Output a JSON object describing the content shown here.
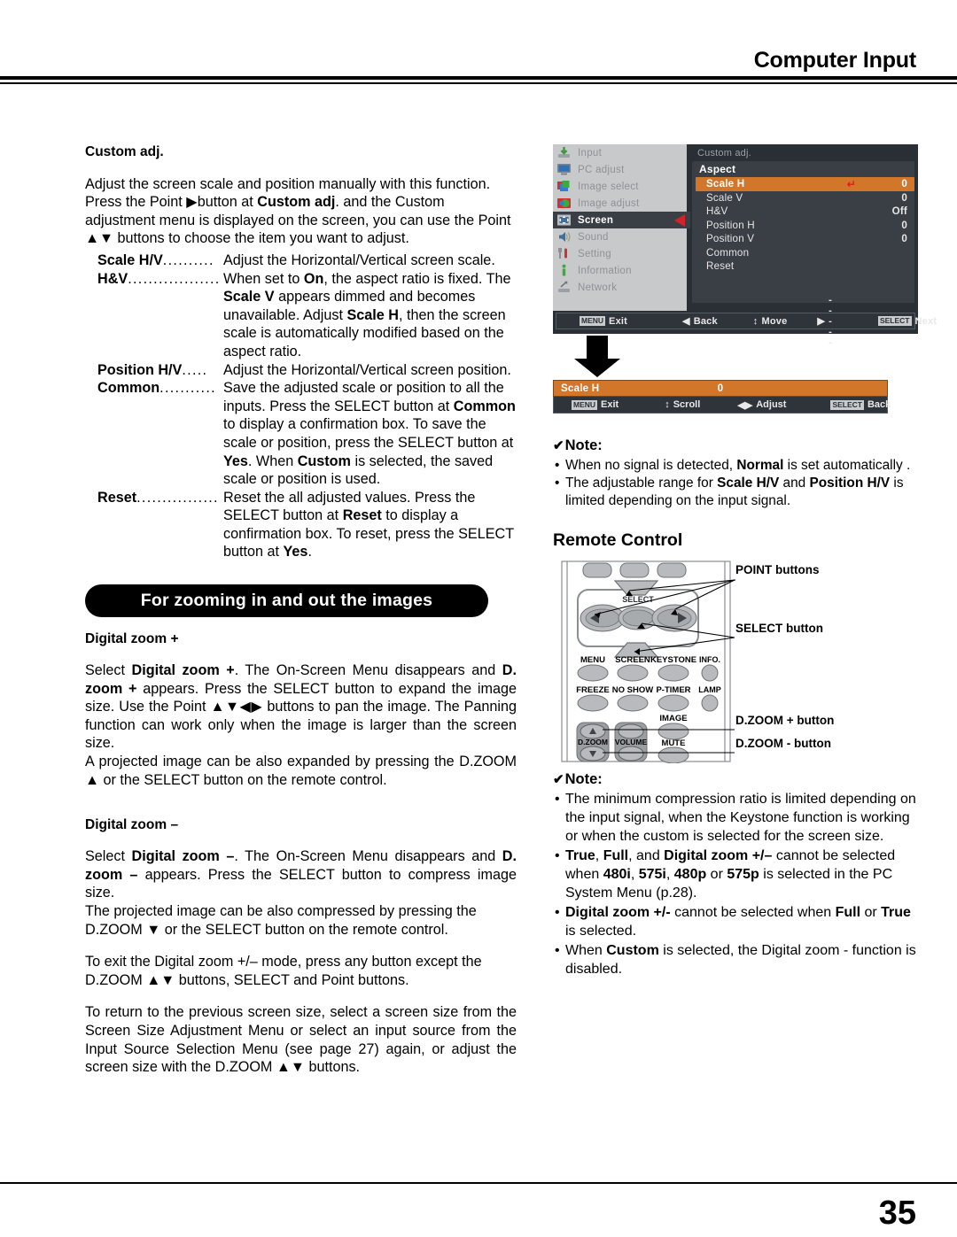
{
  "header": {
    "title": "Computer Input"
  },
  "footer": {
    "page_number": "35"
  },
  "left": {
    "section_title": "Custom adj.",
    "intro_p1": "Adjust the screen scale and position manually with this function.",
    "intro_p2_a": "Press the Point ",
    "intro_p2_arrow": "▶",
    "intro_p2_b": "button at ",
    "intro_p2_bold": "Custom adj",
    "intro_p2_c": ". and the Custom adjustment menu is displayed on the screen, you can use the Point ",
    "intro_p2_updown": "▲▼",
    "intro_p2_d": " buttons to choose the item you want to adjust.",
    "definitions": [
      {
        "term": "Scale H/V",
        "dots": "..........",
        "desc": "Adjust the Horizontal/Vertical screen scale."
      },
      {
        "term": "H&V",
        "dots": "..................",
        "desc_1": "When set to ",
        "desc_b1": "On",
        "desc_2": ", the aspect ratio is fixed. The ",
        "desc_b2": "Scale V",
        "desc_3": " appears dimmed and becomes unavailable. Adjust ",
        "desc_b3": "Scale H",
        "desc_4": ", then the screen scale is automatically modified based on the aspect ratio."
      },
      {
        "term": "Position H/V",
        "dots": ".....",
        "desc": "Adjust the Horizontal/Vertical screen position."
      },
      {
        "term": "Common",
        "dots": "...........",
        "desc_1": "Save the adjusted scale or position to all the inputs. Press the SELECT button at ",
        "desc_b1": "Common",
        "desc_2": " to display a confirmation box. To save the scale or position, press the SELECT button at ",
        "desc_b2": "Yes",
        "desc_3": ". When ",
        "desc_b3": "Custom",
        "desc_4": " is selected, the saved scale or position is used."
      },
      {
        "term": "Reset",
        "dots": "................",
        "desc_1": "Reset the all adjusted values. Press the SELECT button at ",
        "desc_b1": "Reset",
        "desc_2": " to display a confirmation box. To reset, press the SELECT button at ",
        "desc_b2": "Yes",
        "desc_3": "."
      }
    ],
    "banner_label": "For zooming in and out the images",
    "zoom_plus_head": "Digital zoom +",
    "zoom_plus_p1_a": "Select ",
    "zoom_plus_p1_b1": "Digital zoom +",
    "zoom_plus_p1_b": ". The On-Screen Menu disappears and ",
    "zoom_plus_p1_b2": "D. zoom +",
    "zoom_plus_p1_c": " appears. Press the SELECT button to expand the image size. Use the Point ",
    "zoom_plus_p1_arrows": "▲▼◀▶",
    "zoom_plus_p1_d": " buttons to pan the image. The Panning function can work only when the image is larger than the screen size.",
    "zoom_plus_p2_a": "A projected image can be also expanded by pressing the D.ZOOM ",
    "zoom_plus_p2_arrow": "▲",
    "zoom_plus_p2_b": " or the SELECT button on the remote control.",
    "zoom_minus_head": "Digital zoom –",
    "zoom_minus_p1_a": "Select ",
    "zoom_minus_p1_b1": "Digital zoom –",
    "zoom_minus_p1_b": ". The On-Screen Menu disappears and ",
    "zoom_minus_p1_b2": "D. zoom –",
    "zoom_minus_p1_c": " appears. Press the SELECT button to compress image size.",
    "zoom_minus_p2_a": "The projected image can be also compressed by pressing the D.ZOOM ",
    "zoom_minus_p2_arrow": "▼",
    "zoom_minus_p2_b": " or the SELECT button on the remote control.",
    "exit_p_a": "To exit the Digital zoom +/– mode, press any button except the D.ZOOM ",
    "exit_p_arrows": "▲▼",
    "exit_p_b": " buttons, SELECT and Point buttons.",
    "return_p_a": "To return to the previous screen size, select a screen size from the Screen Size Adjustment Menu or select an input source from the Input Source Selection Menu (see page 27) again, or adjust the screen size with the D.ZOOM ",
    "return_p_arrows": "▲▼",
    "return_p_b": " buttons."
  },
  "osd": {
    "sidebar": [
      {
        "label": "Input",
        "icon": "input-icon",
        "selected": false
      },
      {
        "label": "PC adjust",
        "icon": "monitor-icon",
        "selected": false
      },
      {
        "label": "Image select",
        "icon": "image-select-icon",
        "selected": false
      },
      {
        "label": "Image adjust",
        "icon": "image-adjust-icon",
        "selected": false
      },
      {
        "label": "Screen",
        "icon": "screen-icon",
        "selected": true
      },
      {
        "label": "Sound",
        "icon": "speaker-icon",
        "selected": false
      },
      {
        "label": "Setting",
        "icon": "tools-icon",
        "selected": false
      },
      {
        "label": "Information",
        "icon": "info-icon",
        "selected": false
      },
      {
        "label": "Network",
        "icon": "network-icon",
        "selected": false
      }
    ],
    "breadcrumb": "Custom adj.",
    "panel_title": "Aspect",
    "rows": [
      {
        "label": "Scale H",
        "value": "0",
        "highlighted": true,
        "return_mark": "↵"
      },
      {
        "label": "Scale V",
        "value": "0",
        "highlighted": false
      },
      {
        "label": "H&V",
        "value": "Off",
        "highlighted": false
      },
      {
        "label": "Position H",
        "value": "0",
        "highlighted": false
      },
      {
        "label": "Position V",
        "value": "0",
        "highlighted": false
      },
      {
        "label": "Common",
        "value": "",
        "highlighted": false
      },
      {
        "label": "Reset",
        "value": "",
        "highlighted": false
      }
    ],
    "bottom_bar": [
      {
        "key": "MENU",
        "label": "Exit"
      },
      {
        "key": "◀",
        "label": "Back"
      },
      {
        "key": "↕",
        "label": "Move"
      },
      {
        "key": "▶",
        "label": "- - - - -"
      },
      {
        "key": "SELECT",
        "label": "Next"
      }
    ],
    "scale_bar": {
      "name": "Scale H",
      "value": "0",
      "bottom_bar": [
        {
          "key": "MENU",
          "label": "Exit"
        },
        {
          "key": "↕",
          "label": "Scroll"
        },
        {
          "key": "◀▶",
          "label": "Adjust"
        },
        {
          "key": "SELECT",
          "label": "Back"
        }
      ]
    },
    "colors": {
      "highlight": "#d2762a",
      "panel": "#3a3f46",
      "sidebar": "#c8c9cb",
      "caret": "#d2222a"
    }
  },
  "note_top": {
    "title": "Note:",
    "items": [
      {
        "a": "When no signal is detected, ",
        "b1": "Normal",
        "c": " is set automatically ."
      },
      {
        "a": "The adjustable range for ",
        "b1": "Scale H/V",
        "c": " and ",
        "b2": "Position H/V",
        "d": " is limited depending on the input signal."
      }
    ]
  },
  "remote": {
    "heading": "Remote Control",
    "buttons": {
      "menu": "MENU",
      "screen": "SCREEN",
      "keystone": "KEYSTONE",
      "info": "INFO.",
      "freeze": "FREEZE",
      "no_show": "NO SHOW",
      "p_timer": "P-TIMER",
      "lamp": "LAMP",
      "image": "IMAGE",
      "mute": "MUTE",
      "d_zoom": "D.ZOOM",
      "volume": "VOLUME",
      "select": "SELECT"
    },
    "callouts": [
      {
        "label": "POINT buttons",
        "name": "point-buttons-callout"
      },
      {
        "label": "SELECT button",
        "name": "select-button-callout"
      },
      {
        "label": "D.ZOOM + button",
        "name": "dzoom-plus-callout"
      },
      {
        "label": "D.ZOOM - button",
        "name": "dzoom-minus-callout"
      }
    ]
  },
  "note_bottom": {
    "title": "Note:",
    "items": [
      {
        "a": "The minimum compression ratio is limited depending on the input signal, when the Keystone function is working or when the custom is selected for the screen size."
      },
      {
        "b1": "True",
        "a": ", ",
        "b2": "Full",
        "c": ", and ",
        "b3": "Digital zoom +/–",
        "d": " cannot be selected when ",
        "b4": "480i",
        "e": ", ",
        "b5": "575i",
        "f": ", ",
        "b6": "480p",
        "g": " or ",
        "b7": "575p",
        "h": " is selected in the PC System Menu (p.28)."
      },
      {
        "b1": "Digital zoom +/-",
        "a": " cannot be selected when ",
        "b2": "Full",
        "c": " or ",
        "b3": "True",
        "d": " is selected."
      },
      {
        "a": "When ",
        "b1": "Custom",
        "c": " is selected, the Digital zoom - function is disabled."
      }
    ]
  }
}
